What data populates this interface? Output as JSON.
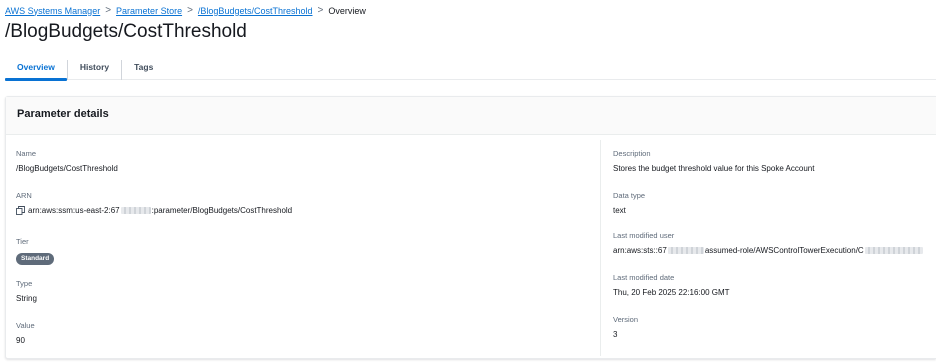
{
  "breadcrumb": {
    "items": [
      "AWS Systems Manager",
      "Parameter Store",
      "/BlogBudgets/CostThreshold"
    ],
    "current": "Overview",
    "separator": ">"
  },
  "page": {
    "title": "/BlogBudgets/CostThreshold"
  },
  "tabs": [
    {
      "label": "Overview",
      "active": true
    },
    {
      "label": "History",
      "active": false
    },
    {
      "label": "Tags",
      "active": false
    }
  ],
  "details": {
    "header": "Parameter details",
    "left": {
      "name": {
        "label": "Name",
        "value": "/BlogBudgets/CostThreshold"
      },
      "arn": {
        "label": "ARN",
        "prefix": "arn:aws:ssm:us-east-2:67",
        "suffix": ":parameter/BlogBudgets/CostThreshold",
        "icon": "copy-icon"
      },
      "tier": {
        "label": "Tier",
        "value": "Standard"
      },
      "type": {
        "label": "Type",
        "value": "String"
      },
      "value": {
        "label": "Value",
        "value": "90"
      }
    },
    "right": {
      "description": {
        "label": "Description",
        "value": "Stores the budget threshold value for this Spoke Account"
      },
      "data_type": {
        "label": "Data type",
        "value": "text"
      },
      "last_modified_user": {
        "label": "Last modified user",
        "prefix": "arn:aws:sts::67",
        "suffix": "assumed-role/AWSControlTowerExecution/C"
      },
      "last_modified_date": {
        "label": "Last modified date",
        "value": "Thu, 20 Feb 2025 22:16:00 GMT"
      },
      "version": {
        "label": "Version",
        "value": "3"
      }
    }
  },
  "colors": {
    "link": "#0972d3",
    "text": "#16191f",
    "label": "#5f6b7a",
    "badge_bg": "#5f6b7a",
    "border": "#e9ebed"
  }
}
